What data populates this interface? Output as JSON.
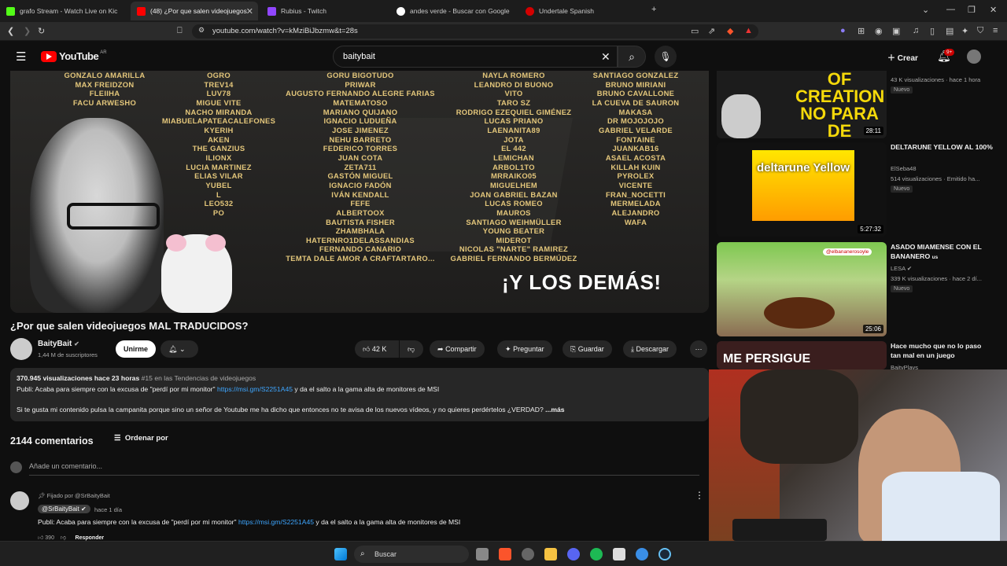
{
  "browser": {
    "tabs": [
      {
        "title": "grafo Stream - Watch Live on Kic",
        "color": "#53fc18"
      },
      {
        "title": "(48) ¿Por que salen videojuegos",
        "color": "#ff0000"
      },
      {
        "title": "Rubius - Twitch",
        "color": "#9146ff"
      },
      {
        "title": "andes verde - Buscar con Google",
        "color": "#ffffff"
      },
      {
        "title": "Undertale Spanish",
        "color": "#d30000"
      }
    ],
    "url": "youtube.com/watch?v=kMziBiJbzmw&t=28s"
  },
  "yt": {
    "logo": "YouTube",
    "region": "AR",
    "search_value": "baitybait",
    "create_label": "Crear",
    "notif_count": "9+"
  },
  "video": {
    "credits": {
      "col1": [
        "GONZALO AMARILLA",
        "MAX FREIDZON",
        "FLEIIHA",
        "FACU ARWESHO",
        "",
        "NACHO MIRANDA",
        "MIABUELAPATEACALEFONES",
        "KYERIH",
        "AKEN",
        "THE GANZIUS",
        "ILIONX",
        "LUCIA MARTINEZ",
        "ELIAS VILAR",
        "YUBEL",
        "L",
        "LEO532",
        "PO"
      ],
      "col2": [
        "OGRO",
        "TREV14",
        "LUV78",
        "MIGUE VITE"
      ],
      "col3": [
        "GORU BIGOTUDO",
        "PRIWAR",
        "AUGUSTO FERNANDO ALEGRE FARIAS",
        "MATEMATOSO",
        "MARIANO QUIJANO",
        "IGNACIO LUDUEÑA",
        "JOSE JIMENEZ",
        "NEHU BARRETO",
        "FEDERICO TORRES",
        "JUAN COTA",
        "ZETA711",
        "GASTÓN MIGUEL",
        "IGNACIO FADÓN",
        "IVÁN KENDALL",
        "FEFE",
        "ALBERTOOX",
        "BAUTISTA FISHER",
        "ZHAMBHALA",
        "HATERNRO1DELASSANDIAS",
        "FERNANDO CANARIO",
        "TEMTA DALE AMOR A CRAFTARTARO..."
      ],
      "col4": [
        "NAYLA ROMERO",
        "LEANDRO DI BUONO",
        "VITO",
        "TARO SZ",
        "RODRIGO EZEQUIEL GIMÉNEZ",
        "LUCAS PRIANO",
        "LAENANITA89",
        "JOTA",
        "EL 442",
        "LEMICHAN",
        "ARBOL1TO",
        "MRRAIKO05",
        "MIGUELHEM",
        "JOAN GABRIEL BAZAN",
        "LUCAS ROMEO",
        "MAUROS",
        "SANTIAGO WEIHMÜLLER",
        "YOUNG BEATER",
        "MIDEROT",
        "NICOLAS \"NARTE\" RAMIREZ",
        "GABRIEL FERNANDO BERMÚDEZ"
      ],
      "col5": [
        "SANTIAGO GONZALEZ",
        "BRUNO MIRIANI",
        "BRUNO CAVALLONE",
        "LA CUEVA DE SAURON",
        "MAKASA",
        "DR MOJOJOJO",
        "GABRIEL VELARDE",
        "FONTAINE",
        "JUANKAB16",
        "ASAEL ACOSTA",
        "KILLAH KUIN",
        "PYROLEX",
        "VICENTE",
        "FRAN_NOCETTI",
        "MERMELADA",
        "ALEJANDRO",
        "WAFA"
      ],
      "col2b": [
        "NACHO MIRANDA"
      ]
    },
    "overlay_text": "¡Y LOS DEMÁS!",
    "title": "¿Por que salen videojuegos MAL TRADUCIDOS?"
  },
  "channel": {
    "name": "BaityBait",
    "subs": "1,44 M de suscriptores",
    "join": "Unirme"
  },
  "actions": {
    "likes": "42 K",
    "share": "Compartir",
    "ask": "Preguntar",
    "save": "Guardar",
    "download": "Descargar"
  },
  "description": {
    "views": "370.945 visualizaciones",
    "time": "hace 23 horas",
    "trend": "#15 en las Tendencias de videojuegos",
    "line1_a": "Publi: Acaba para siempre con la excusa de \"perdí por mi monitor\"",
    "line1_link": "https://msi.gm/S2251A45",
    "line1_b": "y da el salto a la gama alta de monitores de MSI",
    "line2": "Si te gusta mi contenido pulsa la campanita porque sino un señor de Youtube me ha dicho que entonces no te avisa de los nuevos vídeos, y no quieres perdértelos ¿VERDAD?",
    "more": "...más"
  },
  "comments": {
    "count": "2144 comentarios",
    "sort": "Ordenar por",
    "add_placeholder": "Añade un comentario...",
    "pinned_by": "Fijado por @SrBaityBait",
    "author": "@SrBaityBait",
    "time": "hace 1 día",
    "text_a": "Publi: Acaba para siempre con la excusa de \"perdí por mi monitor\"",
    "text_link": "https://msi.gm/S2251A45",
    "text_b": "y da el salto a la gama alta de monitores de MSI",
    "likes": "390",
    "reply": "Responder"
  },
  "sidebar": [
    {
      "thumb_text": "OF CREATION NO PARA DE CRECER",
      "duration": "28:11",
      "title": "",
      "meta": "43 K visualizaciones · hace 1 hora",
      "badge": "Nuevo"
    },
    {
      "thumb_text": "deltarune Yellow",
      "duration": "5:27:32",
      "title": "DELTARUNE YELLOW AL 100%",
      "channel": "ElSeba48",
      "meta": "514 visualizaciones · Emitido ha...",
      "badge": "Nuevo"
    },
    {
      "thumb_text": "@elbananerosoyle",
      "duration": "25:06",
      "title": "ASADO MIAMENSE CON EL BANANERO",
      "title_suffix": "us",
      "channel": "LESA",
      "meta": "339 K visualizaciones · hace 2 dí...",
      "badge": "Nuevo"
    },
    {
      "thumb_text": "ME PERSIGUE",
      "duration": "",
      "title": "Hace mucho que no lo paso tan mal en un juego",
      "channel": "BaityPlays",
      "meta": "",
      "badge": ""
    }
  ],
  "taskbar": {
    "search": "Buscar"
  }
}
